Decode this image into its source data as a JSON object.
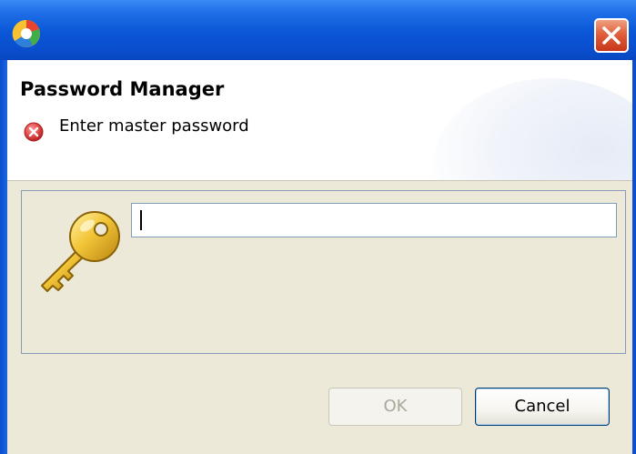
{
  "window": {
    "app_icon": "eclipse-app-icon",
    "close_icon": "close-icon"
  },
  "banner": {
    "title": "Password Manager",
    "message_icon": "error-icon",
    "message": "Enter master password"
  },
  "content": {
    "key_icon": "key-icon",
    "password": {
      "value": "",
      "placeholder": ""
    }
  },
  "buttons": {
    "ok_label": "OK",
    "ok_enabled": false,
    "cancel_label": "Cancel"
  },
  "colors": {
    "titlebar": "#0a56d6",
    "close_button": "#e0603b",
    "error_icon": "#e04a4a",
    "dialog_background": "#ece9d8"
  }
}
